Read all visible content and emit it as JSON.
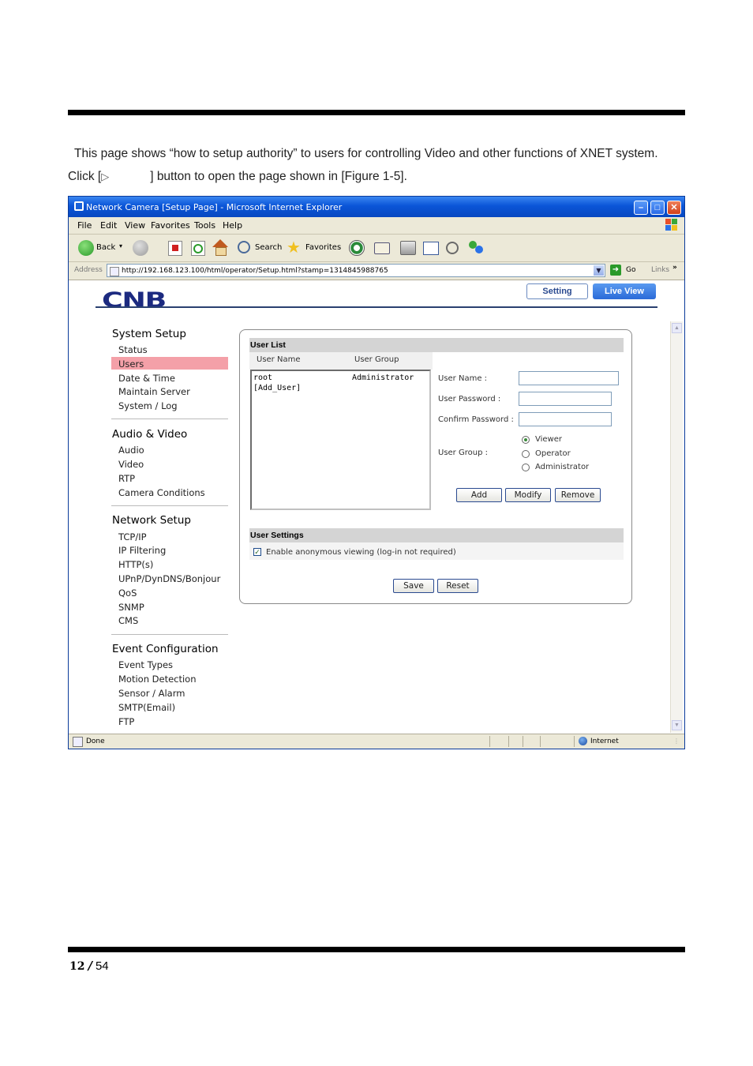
{
  "intro": {
    "line1": "This page shows “how to setup authority” to users for controlling Video and other functions of XNET system.",
    "line2_a": "Click [",
    "line2_b": "] button to open the page shown in [Figure 1-5]."
  },
  "window": {
    "title": "Network Camera [Setup Page] - Microsoft Internet Explorer",
    "menu": [
      "File",
      "Edit",
      "View",
      "Favorites",
      "Tools",
      "Help"
    ],
    "toolbar": {
      "back": "Back",
      "search": "Search",
      "favorites": "Favorites"
    },
    "address_label": "Address",
    "url": "http://192.168.123.100/html/operator/Setup.html?stamp=1314845988765",
    "go": "Go",
    "links": "Links",
    "status_text": "Done",
    "zone": "Internet"
  },
  "page": {
    "logo": "CNB",
    "setting_button": "Setting",
    "live_view_button": "Live View",
    "nav": [
      {
        "heading": "System Setup",
        "items": [
          "Status",
          "Users",
          "Date & Time",
          "Maintain Server",
          "System / Log"
        ]
      },
      {
        "heading": "Audio & Video",
        "items": [
          "Audio",
          "Video",
          "RTP",
          "Camera Conditions"
        ]
      },
      {
        "heading": "Network Setup",
        "items": [
          "TCP/IP",
          "IP Filtering",
          "HTTP(s)",
          "UPnP/DynDNS/Bonjour",
          "QoS",
          "SNMP",
          "CMS"
        ]
      },
      {
        "heading": "Event Configuration",
        "items": [
          "Event Types",
          "Motion Detection",
          "Sensor / Alarm",
          "SMTP(Email)",
          "FTP"
        ]
      }
    ],
    "selected_nav": "Users",
    "user_list": {
      "title": "User List",
      "col_name": "User Name",
      "col_group": "User Group",
      "rows": [
        {
          "name": "root",
          "group": "Administrator"
        },
        {
          "name": "[Add_User]",
          "group": ""
        }
      ]
    },
    "form": {
      "user_name_label": "User Name :",
      "user_password_label": "User Password :",
      "confirm_password_label": "Confirm Password :",
      "user_group_label": "User Group :",
      "groups": [
        "Viewer",
        "Operator",
        "Administrator"
      ],
      "selected_group": "Viewer",
      "add": "Add",
      "modify": "Modify",
      "remove": "Remove"
    },
    "user_settings": {
      "title": "User Settings",
      "anonymous_label": "Enable anonymous viewing (log-in not required)",
      "anonymous_checked": true,
      "save": "Save",
      "reset": "Reset"
    }
  },
  "footer": {
    "page": "12",
    "sep": "/",
    "total": "54"
  }
}
